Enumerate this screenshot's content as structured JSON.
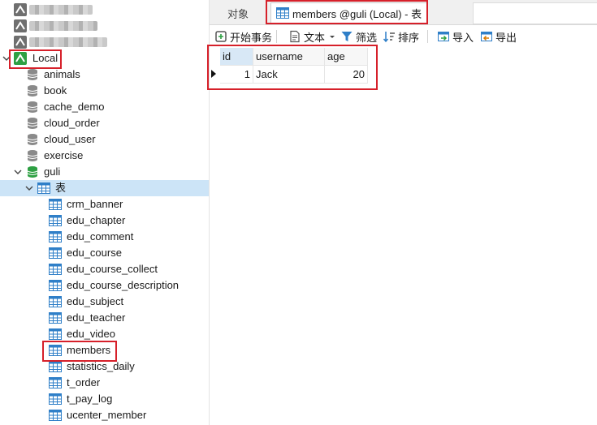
{
  "sidebar": {
    "connections": [
      {
        "name": "redacted-connection-1",
        "blurred": true
      },
      {
        "name": "redacted-connection-2",
        "blurred": true
      },
      {
        "name": "redacted-connection-3",
        "blurred": true
      }
    ],
    "local": {
      "label": "Local"
    },
    "databases": [
      "animals",
      "book",
      "cache_demo",
      "cloud_order",
      "cloud_user",
      "exercise"
    ],
    "open_database": {
      "label": "guli"
    },
    "tables_node": {
      "label": "表"
    },
    "tables": [
      "crm_banner",
      "edu_chapter",
      "edu_comment",
      "edu_course",
      "edu_course_collect",
      "edu_course_description",
      "edu_subject",
      "edu_teacher",
      "edu_video",
      "members",
      "statistics_daily",
      "t_order",
      "t_pay_log",
      "ucenter_member"
    ],
    "highlighted_table": "members"
  },
  "tabs": {
    "objects_label": "对象",
    "active_label": "members @guli (Local) - 表"
  },
  "toolbar": {
    "begin_transaction": "开始事务",
    "text": "文本",
    "filter": "筛选",
    "sort": "排序",
    "import": "导入",
    "export": "导出"
  },
  "grid": {
    "columns": [
      "id",
      "username",
      "age"
    ],
    "rows": [
      {
        "id": "1",
        "username": "Jack",
        "age": "20"
      }
    ]
  },
  "colors": {
    "highlight_red": "#d6202a",
    "selection_blue": "#cce4f7",
    "db_gray": "#8a8a8a",
    "db_green": "#2ea043",
    "table_blue": "#2f7fc8"
  }
}
